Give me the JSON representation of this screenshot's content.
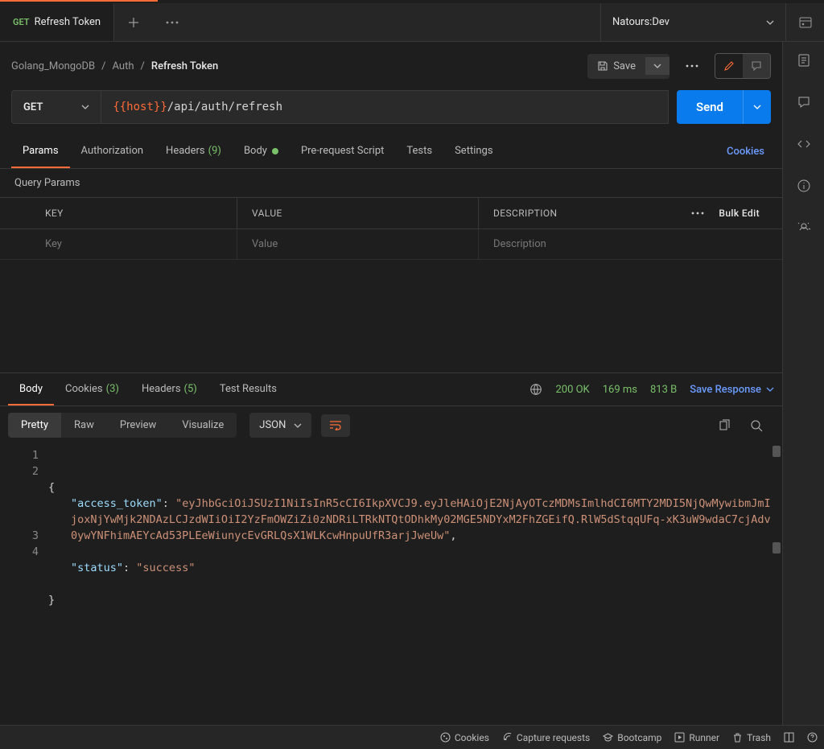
{
  "tab": {
    "method": "GET",
    "title": "Refresh Token"
  },
  "env": {
    "name": "Natours:Dev"
  },
  "breadcrumbs": [
    "Golang_MongoDB",
    "Auth",
    "Refresh Token"
  ],
  "save_label": "Save",
  "url": {
    "method": "GET",
    "var": "{{host}}",
    "path": "/api/auth/refresh"
  },
  "send_label": "Send",
  "req_tabs": {
    "params": "Params",
    "authorization": "Authorization",
    "headers": "Headers",
    "headers_count": "(9)",
    "body": "Body",
    "prereq": "Pre-request Script",
    "tests": "Tests",
    "settings": "Settings"
  },
  "cookies_link": "Cookies",
  "query_params_label": "Query Params",
  "th": {
    "key": "KEY",
    "value": "VALUE",
    "desc": "DESCRIPTION",
    "bulk": "Bulk Edit"
  },
  "ph": {
    "key": "Key",
    "value": "Value",
    "desc": "Description"
  },
  "resp_tabs": {
    "body": "Body",
    "cookies": "Cookies",
    "cookies_count": "(3)",
    "headers": "Headers",
    "headers_count": "(5)",
    "test_results": "Test Results"
  },
  "resp_meta": {
    "status": "200 OK",
    "time": "169 ms",
    "size": "813 B",
    "save": "Save Response"
  },
  "view_tabs": {
    "pretty": "Pretty",
    "raw": "Raw",
    "preview": "Preview",
    "visualize": "Visualize"
  },
  "fmt": "JSON",
  "code": {
    "line_numbers": [
      "1",
      "2",
      "3",
      "4"
    ],
    "l1": "{",
    "l2_key": "\"access_token\"",
    "l2_val": "\"eyJhbGciOiJSUzI1NiIsInR5cCI6IkpXVCJ9.eyJleHAiOjE2NjAyOTczMDMsImlhdCI6MTY2MDI5NjQwMywibmJmIjoxNjYwMjk2NDAzLCJzdWIiOiI2YzFmOWZiZi0zNDRiLTRkNTQtODhkMy02MGE5NDYxM2FhZGEifQ.RlW5dStqqUFq-xK3uW9wdaC7cjAdv0ywYNFhimAEYcAd53PLEeWiunycEvGRLQsX1WLKcwHnpuUfR3arjJweUw\"",
    "l3_key": "\"status\"",
    "l3_val": "\"success\"",
    "l4": "}"
  },
  "footer": {
    "cookies": "Cookies",
    "capture": "Capture requests",
    "bootcamp": "Bootcamp",
    "runner": "Runner",
    "trash": "Trash"
  }
}
